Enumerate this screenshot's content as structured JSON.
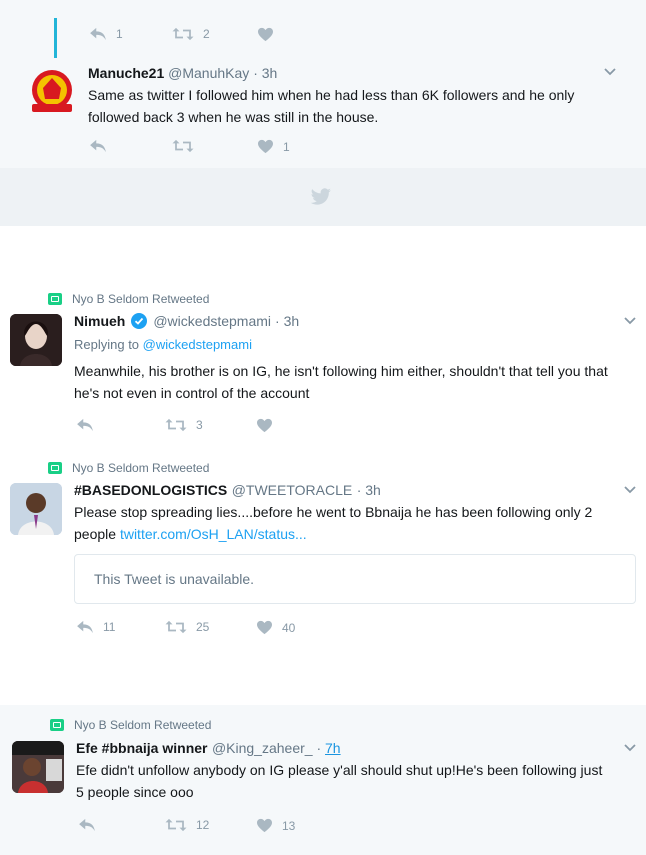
{
  "top_tweet_actions": {
    "reply_count": "1",
    "retweet_count": "2"
  },
  "tweet1": {
    "name": "Manuche21",
    "handle": "@ManuhKay",
    "time": "· 3h",
    "text": "Same as twitter I followed him when he had less than 6K followers and he only followed back 3 when he was still in the house.",
    "like_count": "1"
  },
  "tweet2": {
    "retweeted_by": "Nyo B Seldom Retweeted",
    "name": "Nimueh",
    "verified": true,
    "handle": "@wickedstepmami",
    "time": "· 3h",
    "replying_prefix": "Replying to",
    "replying_to": "@wickedstepmami",
    "text": "Meanwhile, his brother is on IG, he isn't following him either, shouldn't that tell you that he's not even in control of the account",
    "retweet_count": "3"
  },
  "tweet3": {
    "retweeted_by": "Nyo B Seldom Retweeted",
    "name": "#BASEDONLOGISTICS",
    "handle": "@TWEETORACLE",
    "time": "· 3h",
    "text": "Please stop spreading lies....before he went to Bbnaija he has been following only 2 people",
    "link": "twitter.com/OsH_LAN/status...",
    "quote_text": "This Tweet is unavailable.",
    "reply_count": "11",
    "retweet_count": "25",
    "like_count": "40"
  },
  "tweet4": {
    "retweeted_by": "Nyo B Seldom Retweeted",
    "name": "Efe #bbnaija winner",
    "handle": "@King_zaheer_",
    "time_sep": " · ",
    "time": "7h",
    "text": "Efe didn't unfollow anybody on IG please y'all should shut up!He's been following just 5 people since ooo",
    "retweet_count": "12",
    "like_count": "13"
  },
  "colors": {
    "accent": "#1da1f2",
    "retweet_green": "#19cf86",
    "thread_line": "#22b5d8"
  }
}
